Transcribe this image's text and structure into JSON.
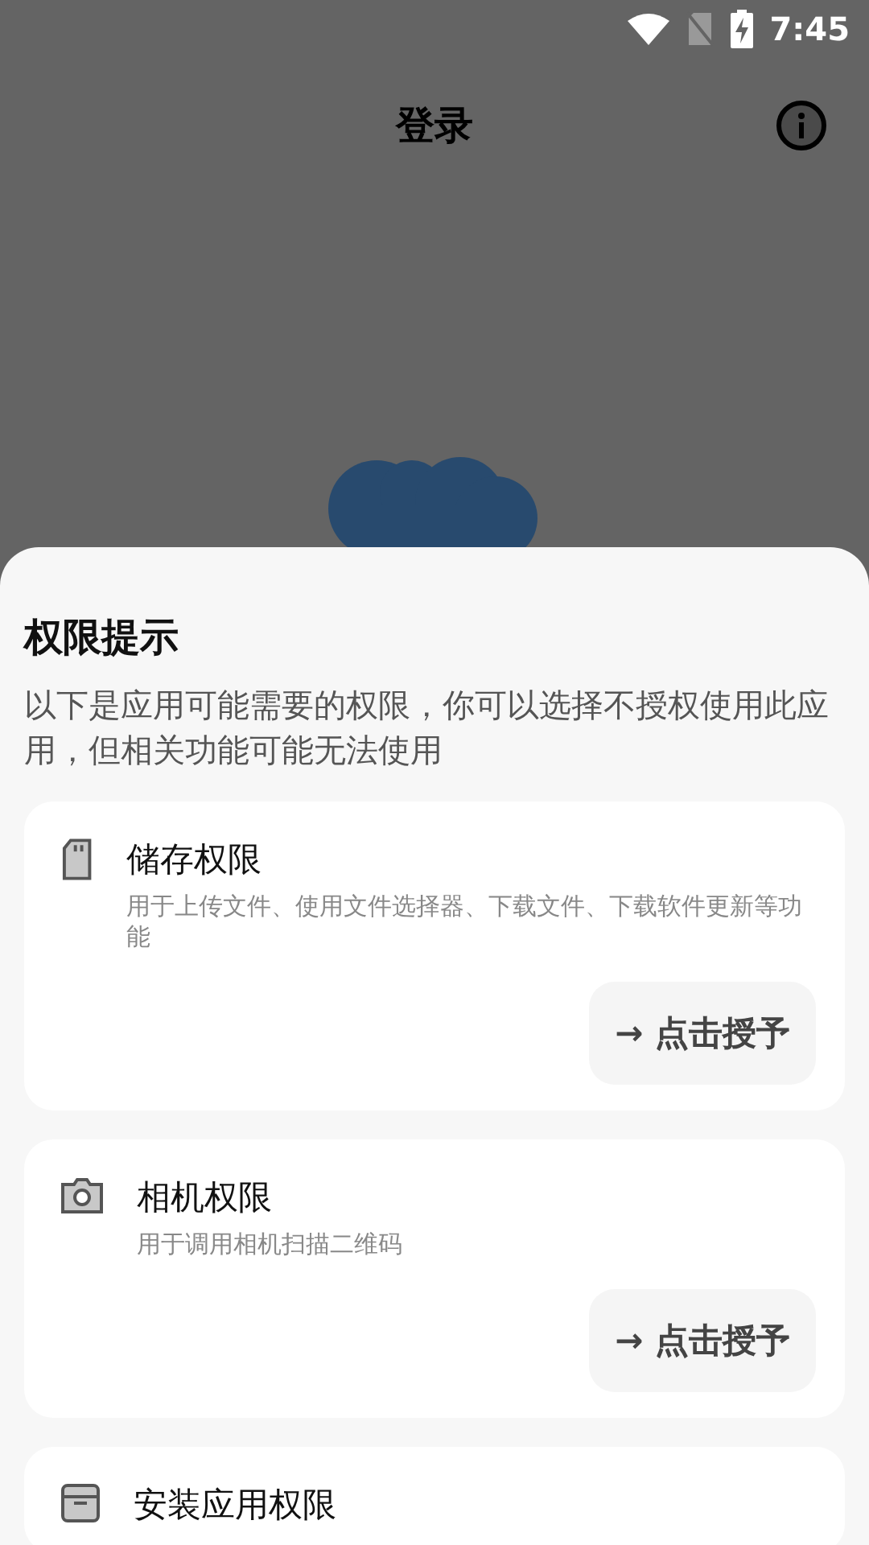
{
  "status_bar": {
    "time": "7:45"
  },
  "app_bar": {
    "title": "登录"
  },
  "sheet": {
    "title": "权限提示",
    "description": "以下是应用可能需要的权限，你可以选择不授权使用此应用，但相关功能可能无法使用",
    "permissions": [
      {
        "kind": "storage",
        "title": "储存权限",
        "description": "用于上传文件、使用文件选择器、下载文件、下载软件更新等功能",
        "button": "→ 点击授予"
      },
      {
        "kind": "camera",
        "title": "相机权限",
        "description": "用于调用相机扫描二维码",
        "button": "→ 点击授予"
      },
      {
        "kind": "install",
        "title": "安装应用权限"
      }
    ]
  }
}
